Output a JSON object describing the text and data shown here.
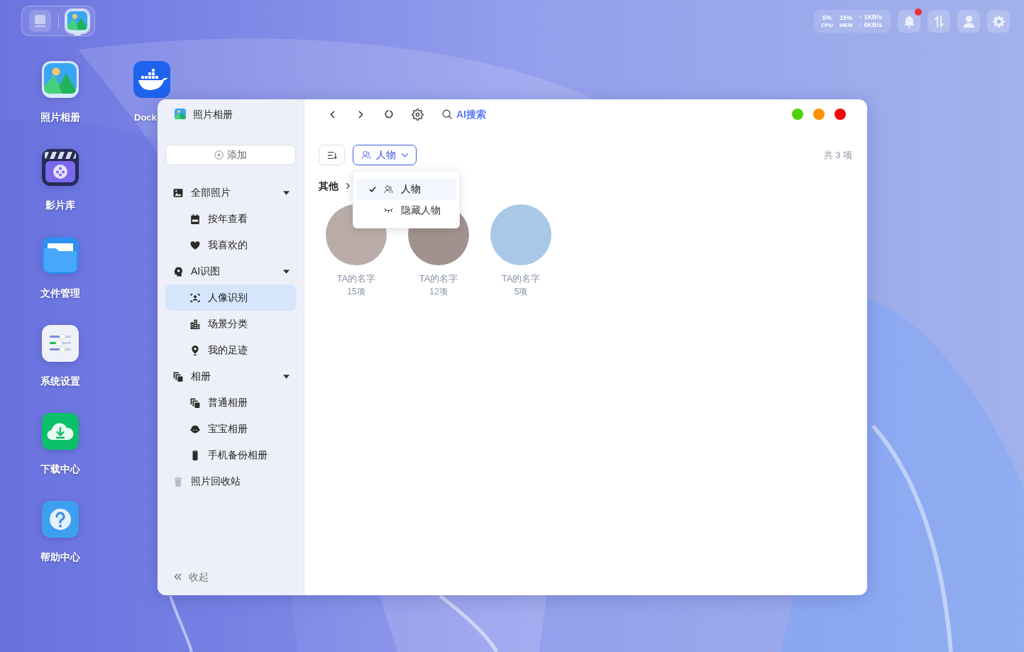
{
  "taskbar": {
    "apps": [
      {
        "selected": false
      },
      {
        "selected": true
      }
    ]
  },
  "desktop": {
    "icons": [
      {
        "label": "照片相册"
      },
      {
        "label": "影片库"
      },
      {
        "label": "文件管理"
      },
      {
        "label": "系统设置"
      },
      {
        "label": "下载中心"
      },
      {
        "label": "帮助中心"
      }
    ],
    "icons_column_2": [
      {
        "label": "Dock"
      }
    ]
  },
  "system_monitor": {
    "cpu": {
      "value": "5%",
      "label": "CPU"
    },
    "memory": {
      "value": "15%",
      "label": "MEM"
    },
    "upload": "↑ 1KB/s",
    "download": "↓ 6KB/s"
  },
  "tray": {
    "notifications": {
      "unread": true
    }
  },
  "window": {
    "title": "照片相册",
    "add_button": "添加",
    "sidebar": {
      "items": [
        {
          "label": "全部照片",
          "selected": false,
          "expanded": true,
          "children": [
            {
              "label": "按年查看",
              "selected": false
            },
            {
              "label": "我喜欢的",
              "selected": false
            }
          ]
        },
        {
          "label": "AI识图",
          "selected": false,
          "expanded": true,
          "children": [
            {
              "label": "人像识别",
              "selected": true
            },
            {
              "label": "场景分类",
              "selected": false
            },
            {
              "label": "我的足迹",
              "selected": false
            }
          ]
        },
        {
          "label": "相册",
          "selected": false,
          "expanded": true,
          "children": [
            {
              "label": "普通相册",
              "selected": false
            },
            {
              "label": "宝宝相册",
              "selected": false
            },
            {
              "label": "手机备份相册",
              "selected": false
            }
          ]
        },
        {
          "label": "照片回收站",
          "selected": false
        }
      ]
    },
    "collapse_button": "收起",
    "toolbar": {
      "search_button": "AI搜索"
    },
    "filter_button": {
      "label": "人物",
      "expanded": true
    },
    "filter_menu": {
      "items": [
        {
          "label": "人物",
          "selected": true
        },
        {
          "label": "隐藏人物",
          "selected": false
        }
      ]
    },
    "item_count": "共 3 项",
    "group": {
      "title": "其他"
    },
    "people": [
      {
        "name": "TA的名字",
        "count": "15项"
      },
      {
        "name": "TA的名字",
        "count": "12项"
      },
      {
        "name": "TA的名字",
        "count": "5项"
      }
    ]
  }
}
